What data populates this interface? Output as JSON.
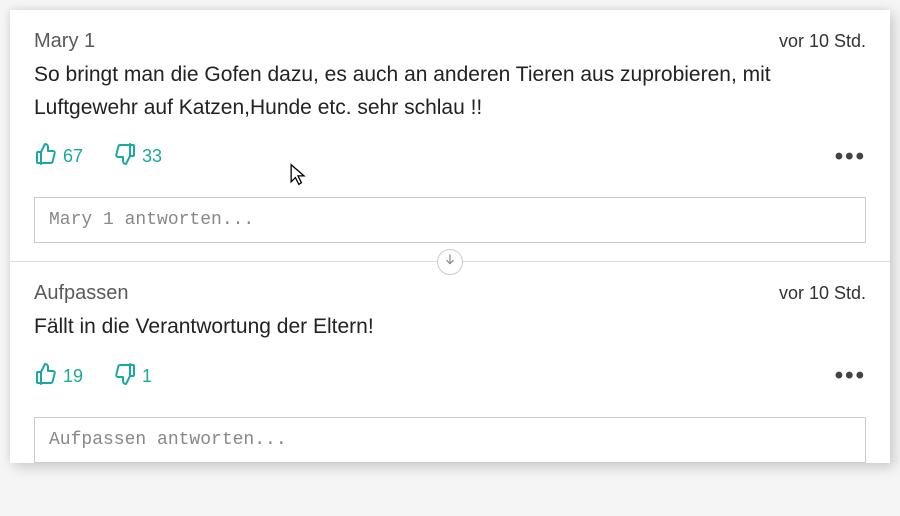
{
  "accent_color": "#1aa9a0",
  "comments": [
    {
      "author": "Mary 1",
      "timestamp": "vor 10 Std.",
      "body": "So bringt man die Gofen dazu, es auch an anderen Tieren aus zuprobieren, mit Luftgewehr auf Katzen,Hunde etc. sehr schlau !!",
      "likes": 67,
      "dislikes": 33,
      "reply_placeholder": "Mary 1 antworten..."
    },
    {
      "author": "Aufpassen",
      "timestamp": "vor 10 Std.",
      "body": "Fällt in die Verantwortung der Eltern!",
      "likes": 19,
      "dislikes": 1,
      "reply_placeholder": "Aufpassen antworten..."
    }
  ],
  "icons": {
    "more": "•••"
  }
}
